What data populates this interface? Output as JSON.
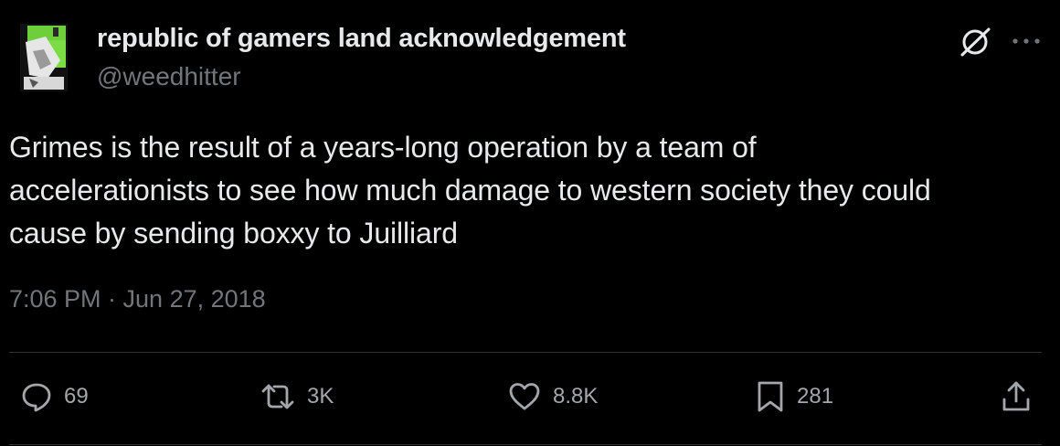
{
  "author": {
    "display_name": "republic of gamers land acknowledgement",
    "handle": "@weedhitter",
    "avatar_icon": "avatar-image"
  },
  "header_actions": {
    "grok_icon": "grok-icon",
    "more_icon": "more-icon"
  },
  "tweet": {
    "text_lines": [
      "Grimes is the result of a years-long operation by a team of",
      "accelerationists to see how much damage to western society they could",
      "cause by sending boxxy to Juilliard"
    ],
    "timestamp": "7:06 PM · Jun 27, 2018"
  },
  "actions": {
    "reply": {
      "icon": "reply-icon",
      "count": "69"
    },
    "retweet": {
      "icon": "retweet-icon",
      "count": "3K"
    },
    "like": {
      "icon": "heart-icon",
      "count": "8.8K"
    },
    "bookmark": {
      "icon": "bookmark-icon",
      "count": "281"
    },
    "share": {
      "icon": "share-icon"
    }
  },
  "colors": {
    "background": "#000000",
    "primary_text": "#e7e9ea",
    "secondary_text": "#71767b",
    "divider": "#2f3336"
  }
}
